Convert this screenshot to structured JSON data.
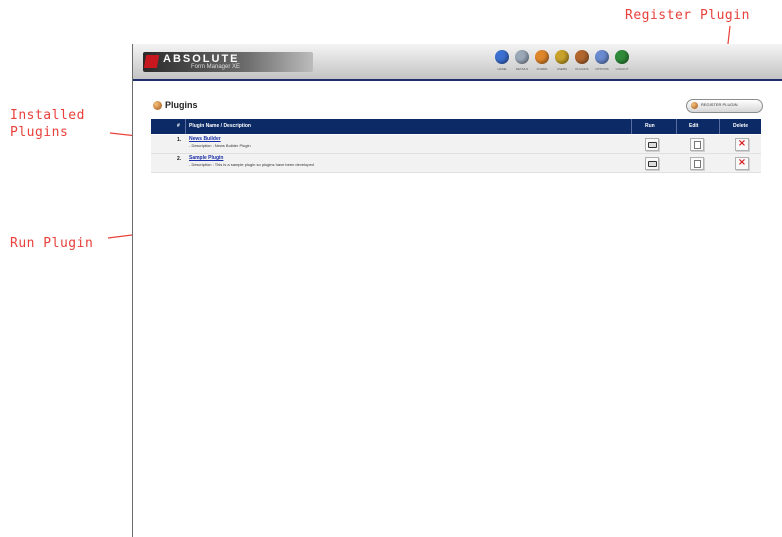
{
  "annotations": {
    "register_plugin": "Register Plugin",
    "installed_plugins_line1": "Installed",
    "installed_plugins_line2": "Plugins",
    "run_plugin": "Run Plugin"
  },
  "app": {
    "logo_title": "ABSOLUTE",
    "logo_subtitle": "Form Manager XE",
    "nav_items": [
      {
        "label": "HOME",
        "icon": "home-icon",
        "color": "#3b6fd1"
      },
      {
        "label": "DETAILS",
        "icon": "details-icon",
        "color": "#9aa8b8"
      },
      {
        "label": "FORMS",
        "icon": "forms-icon",
        "color": "#e0862a"
      },
      {
        "label": "USERS",
        "icon": "users-icon",
        "color": "#c8a22a"
      },
      {
        "label": "PLUGINS",
        "icon": "plugins-icon",
        "color": "#b2662e"
      },
      {
        "label": "OPTIONS",
        "icon": "options-icon",
        "color": "#6a8ad0"
      },
      {
        "label": "LOGOUT",
        "icon": "logout-icon",
        "color": "#2f8a3a"
      }
    ]
  },
  "page": {
    "title": "Plugins",
    "register_button_label": "REGISTER PLUGIN"
  },
  "table": {
    "headers": {
      "number": "#",
      "name": "Plugin Name / Description",
      "run": "Run",
      "edit": "Edit",
      "delete": "Delete"
    },
    "rows": [
      {
        "num": "1.",
        "name": "News Builder",
        "desc": "- Description : News Builder Plugin"
      },
      {
        "num": "2.",
        "name": "Sample Plugin",
        "desc": "- Description : This is a sample plugin so plugins have been developed"
      }
    ],
    "delete_symbol": "×"
  },
  "colors": {
    "annotation": "#e8403a",
    "header_bar": "#0c2a66",
    "delete": "#d8191b"
  }
}
